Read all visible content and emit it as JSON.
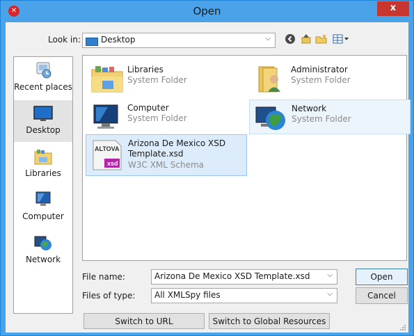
{
  "window": {
    "title": "Open",
    "app_icon": "altova-app-icon",
    "close_label": "x"
  },
  "toolbar": {
    "look_in_label": "Look in:",
    "look_in_value": "Desktop",
    "icons": [
      "back-icon",
      "up-folder-icon",
      "new-folder-icon",
      "view-menu-icon"
    ]
  },
  "places": [
    {
      "label": "Recent places",
      "icon": "recent-places-icon"
    },
    {
      "label": "Desktop",
      "icon": "desktop-icon",
      "selected": true
    },
    {
      "label": "Libraries",
      "icon": "libraries-icon"
    },
    {
      "label": "Computer",
      "icon": "computer-icon"
    },
    {
      "label": "Network",
      "icon": "network-icon"
    }
  ],
  "files": [
    {
      "name": "Libraries",
      "type": "System Folder",
      "icon": "libraries-folder-icon"
    },
    {
      "name": "Administrator",
      "type": "System Folder",
      "icon": "user-folder-icon"
    },
    {
      "name": "Computer",
      "type": "System Folder",
      "icon": "computer-icon"
    },
    {
      "name": "Network",
      "type": "System Folder",
      "icon": "network-icon"
    },
    {
      "name": "Arizona De Mexico XSD Template.xsd",
      "type": "W3C XML Schema",
      "icon": "xsd-file-icon",
      "selected": true
    }
  ],
  "form": {
    "file_name_label": "File name:",
    "file_name_value": "Arizona De Mexico XSD Template.xsd",
    "file_type_label": "Files of type:",
    "file_type_value": "All XMLSpy files",
    "open_label": "Open",
    "cancel_label": "Cancel"
  },
  "bottom_buttons": {
    "switch_url": "Switch to URL",
    "switch_global": "Switch to Global Resources"
  },
  "xsd_badge": {
    "brand": "ALTOVA",
    "ext": "xsd"
  },
  "colors": {
    "titlebar": "#4aa3e8",
    "close": "#c7372f",
    "selection": "#dcecfa"
  }
}
